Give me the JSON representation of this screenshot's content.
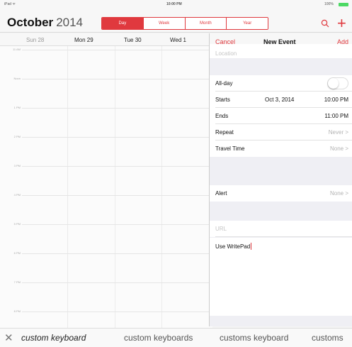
{
  "status_bar": {
    "carrier": "iPad ᯤ",
    "time": "10:00 PM",
    "battery_text": "100%",
    "battery_color": "#4cd964"
  },
  "header": {
    "month": "October",
    "year": "2014",
    "segments": [
      "Day",
      "Week",
      "Month",
      "Year"
    ],
    "active_segment": "Day",
    "accent_color": "#e0393e",
    "search_icon": "search-icon",
    "add_label": "+"
  },
  "day_bar": {
    "days": [
      "Sun 28",
      "Mon 29",
      "Tue 30",
      "Wed 1"
    ]
  },
  "time_grid": {
    "hours": [
      "11 AM",
      "Noon",
      "1 PM",
      "2 PM",
      "3 PM",
      "4 PM",
      "5 PM",
      "6 PM",
      "7 PM",
      "8 PM"
    ]
  },
  "new_event": {
    "cancel_label": "Cancel",
    "title": "New Event",
    "add_label": "Add",
    "location_placeholder": "Location",
    "all_day_label": "All-day",
    "all_day_on": false,
    "starts_label": "Starts",
    "starts_date": "Oct 3, 2014",
    "starts_time": "10:00 PM",
    "ends_label": "Ends",
    "ends_time": "11:00 PM",
    "repeat_label": "Repeat",
    "repeat_value": "Never >",
    "travel_label": "Travel Time",
    "travel_value": "None >",
    "alert_label": "Alert",
    "alert_value": "None >",
    "url_placeholder": "URL",
    "notes_text": "Use WritePad"
  },
  "suggestions": {
    "close_icon": "close-icon",
    "items": [
      "custom keyboard",
      "custom keyboards",
      "customs keyboard",
      "customs"
    ]
  }
}
